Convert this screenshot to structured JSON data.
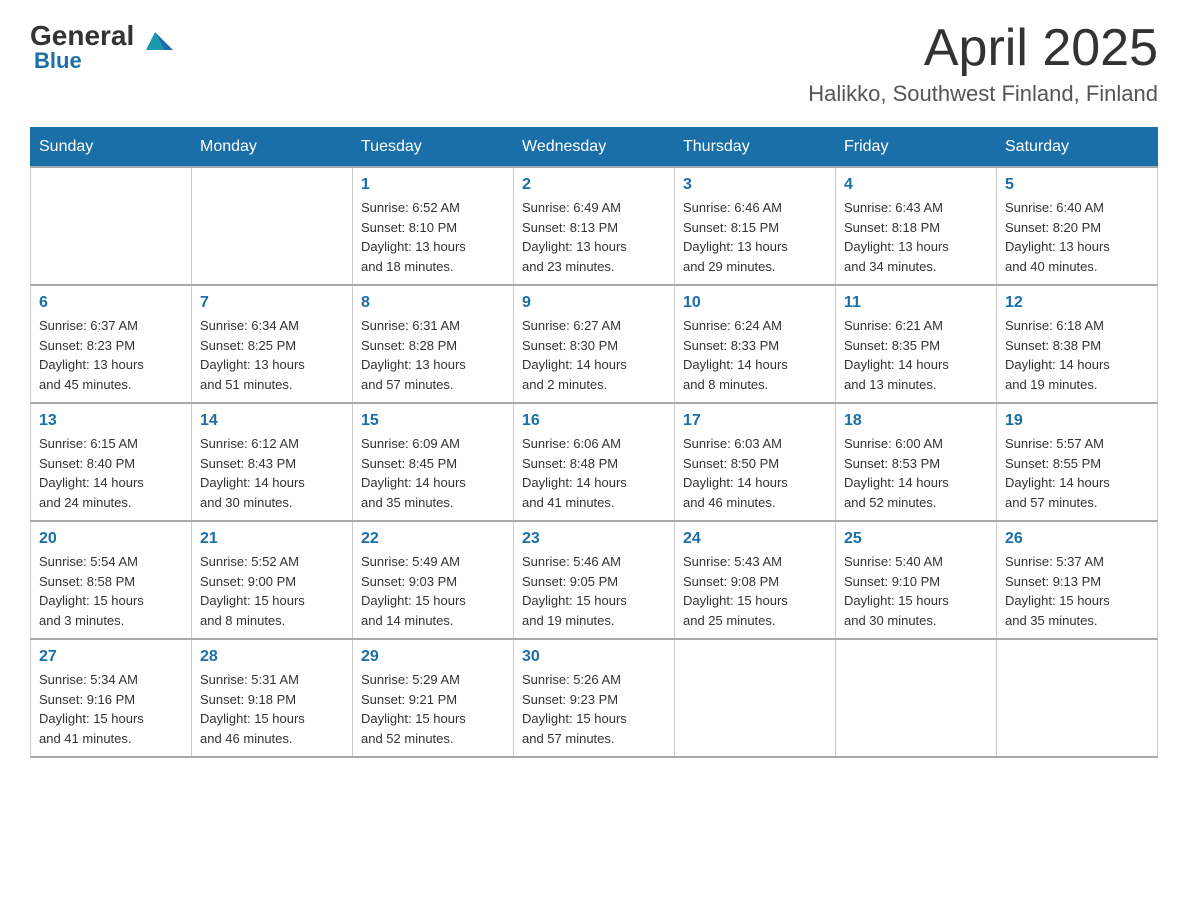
{
  "header": {
    "logo_general": "General",
    "logo_blue": "Blue",
    "month_title": "April 2025",
    "location": "Halikko, Southwest Finland, Finland"
  },
  "weekdays": [
    "Sunday",
    "Monday",
    "Tuesday",
    "Wednesday",
    "Thursday",
    "Friday",
    "Saturday"
  ],
  "weeks": [
    [
      {
        "day": "",
        "info": ""
      },
      {
        "day": "",
        "info": ""
      },
      {
        "day": "1",
        "info": "Sunrise: 6:52 AM\nSunset: 8:10 PM\nDaylight: 13 hours\nand 18 minutes."
      },
      {
        "day": "2",
        "info": "Sunrise: 6:49 AM\nSunset: 8:13 PM\nDaylight: 13 hours\nand 23 minutes."
      },
      {
        "day": "3",
        "info": "Sunrise: 6:46 AM\nSunset: 8:15 PM\nDaylight: 13 hours\nand 29 minutes."
      },
      {
        "day": "4",
        "info": "Sunrise: 6:43 AM\nSunset: 8:18 PM\nDaylight: 13 hours\nand 34 minutes."
      },
      {
        "day": "5",
        "info": "Sunrise: 6:40 AM\nSunset: 8:20 PM\nDaylight: 13 hours\nand 40 minutes."
      }
    ],
    [
      {
        "day": "6",
        "info": "Sunrise: 6:37 AM\nSunset: 8:23 PM\nDaylight: 13 hours\nand 45 minutes."
      },
      {
        "day": "7",
        "info": "Sunrise: 6:34 AM\nSunset: 8:25 PM\nDaylight: 13 hours\nand 51 minutes."
      },
      {
        "day": "8",
        "info": "Sunrise: 6:31 AM\nSunset: 8:28 PM\nDaylight: 13 hours\nand 57 minutes."
      },
      {
        "day": "9",
        "info": "Sunrise: 6:27 AM\nSunset: 8:30 PM\nDaylight: 14 hours\nand 2 minutes."
      },
      {
        "day": "10",
        "info": "Sunrise: 6:24 AM\nSunset: 8:33 PM\nDaylight: 14 hours\nand 8 minutes."
      },
      {
        "day": "11",
        "info": "Sunrise: 6:21 AM\nSunset: 8:35 PM\nDaylight: 14 hours\nand 13 minutes."
      },
      {
        "day": "12",
        "info": "Sunrise: 6:18 AM\nSunset: 8:38 PM\nDaylight: 14 hours\nand 19 minutes."
      }
    ],
    [
      {
        "day": "13",
        "info": "Sunrise: 6:15 AM\nSunset: 8:40 PM\nDaylight: 14 hours\nand 24 minutes."
      },
      {
        "day": "14",
        "info": "Sunrise: 6:12 AM\nSunset: 8:43 PM\nDaylight: 14 hours\nand 30 minutes."
      },
      {
        "day": "15",
        "info": "Sunrise: 6:09 AM\nSunset: 8:45 PM\nDaylight: 14 hours\nand 35 minutes."
      },
      {
        "day": "16",
        "info": "Sunrise: 6:06 AM\nSunset: 8:48 PM\nDaylight: 14 hours\nand 41 minutes."
      },
      {
        "day": "17",
        "info": "Sunrise: 6:03 AM\nSunset: 8:50 PM\nDaylight: 14 hours\nand 46 minutes."
      },
      {
        "day": "18",
        "info": "Sunrise: 6:00 AM\nSunset: 8:53 PM\nDaylight: 14 hours\nand 52 minutes."
      },
      {
        "day": "19",
        "info": "Sunrise: 5:57 AM\nSunset: 8:55 PM\nDaylight: 14 hours\nand 57 minutes."
      }
    ],
    [
      {
        "day": "20",
        "info": "Sunrise: 5:54 AM\nSunset: 8:58 PM\nDaylight: 15 hours\nand 3 minutes."
      },
      {
        "day": "21",
        "info": "Sunrise: 5:52 AM\nSunset: 9:00 PM\nDaylight: 15 hours\nand 8 minutes."
      },
      {
        "day": "22",
        "info": "Sunrise: 5:49 AM\nSunset: 9:03 PM\nDaylight: 15 hours\nand 14 minutes."
      },
      {
        "day": "23",
        "info": "Sunrise: 5:46 AM\nSunset: 9:05 PM\nDaylight: 15 hours\nand 19 minutes."
      },
      {
        "day": "24",
        "info": "Sunrise: 5:43 AM\nSunset: 9:08 PM\nDaylight: 15 hours\nand 25 minutes."
      },
      {
        "day": "25",
        "info": "Sunrise: 5:40 AM\nSunset: 9:10 PM\nDaylight: 15 hours\nand 30 minutes."
      },
      {
        "day": "26",
        "info": "Sunrise: 5:37 AM\nSunset: 9:13 PM\nDaylight: 15 hours\nand 35 minutes."
      }
    ],
    [
      {
        "day": "27",
        "info": "Sunrise: 5:34 AM\nSunset: 9:16 PM\nDaylight: 15 hours\nand 41 minutes."
      },
      {
        "day": "28",
        "info": "Sunrise: 5:31 AM\nSunset: 9:18 PM\nDaylight: 15 hours\nand 46 minutes."
      },
      {
        "day": "29",
        "info": "Sunrise: 5:29 AM\nSunset: 9:21 PM\nDaylight: 15 hours\nand 52 minutes."
      },
      {
        "day": "30",
        "info": "Sunrise: 5:26 AM\nSunset: 9:23 PM\nDaylight: 15 hours\nand 57 minutes."
      },
      {
        "day": "",
        "info": ""
      },
      {
        "day": "",
        "info": ""
      },
      {
        "day": "",
        "info": ""
      }
    ]
  ]
}
